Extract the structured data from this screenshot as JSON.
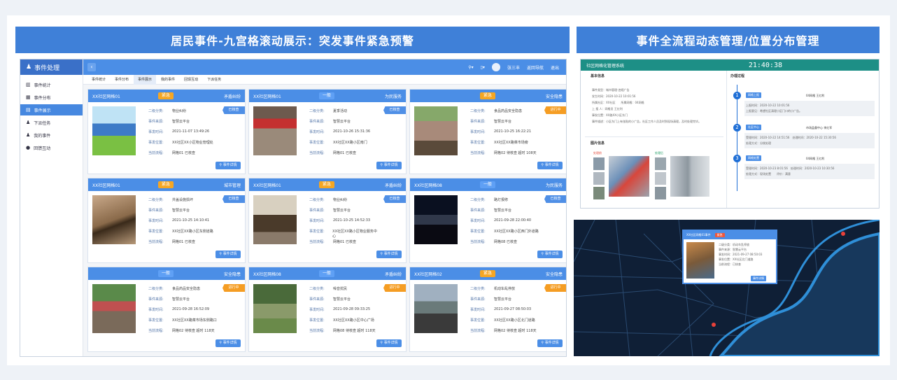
{
  "banners": {
    "left": "居民事件-九宫格滚动展示：突发事件紧急预警",
    "right": "事件全流程动态管理/位置分布管理"
  },
  "app": {
    "brand": "事件处理",
    "collapse": "‹",
    "menu": [
      {
        "icon": "bar-chart-icon",
        "glyph": "▥",
        "label": "事件统计"
      },
      {
        "icon": "map-icon",
        "glyph": "▦",
        "label": "事件分布"
      },
      {
        "icon": "list-icon",
        "glyph": "▤",
        "label": "事件展示"
      },
      {
        "icon": "user-icon",
        "glyph": "♟",
        "label": "下派任务"
      },
      {
        "icon": "user-icon",
        "glyph": "♟",
        "label": "我的事件"
      },
      {
        "icon": "chat-icon",
        "glyph": "●",
        "label": "回馈互动"
      }
    ],
    "top_user": "张三丰",
    "top_nav": "返回导航",
    "top_exit": "退出",
    "tabs": [
      "事件统计",
      "事件分布",
      "事件展示",
      "我的事件",
      "回馈互动",
      "下派任务"
    ],
    "field_labels": [
      "二级分类:",
      "事件来源:",
      "事发时间:",
      "事发位置:",
      "当前流程:"
    ],
    "detail_label": "事件详情",
    "cards": [
      {
        "grid": "XX社区网格01",
        "badge": "紧急",
        "badge_color": "#f5a623",
        "cat": "矛盾纠纷",
        "type": "物业纠纷",
        "source": "智慧云平台",
        "time": "2021-11-07 13:49:26",
        "place": "XX社区XX小区物业管理处",
        "flow": "网格01 已核查",
        "status": "已核查",
        "status_color": "#4f8fe6",
        "photo": "cartoon"
      },
      {
        "grid": "XX社区网格01",
        "badge": "一般",
        "badge_color": "#5fa0f5",
        "cat": "为民服务",
        "type": "夏季活动",
        "source": "智慧云平台",
        "time": "2021-10-26 15:31:36",
        "place": "XX社区XX路小区南门",
        "flow": "网格01 已核查",
        "status": "已核查",
        "status_color": "#4f8fe6",
        "photo": "shop"
      },
      {
        "grid": "",
        "badge": "紧急",
        "badge_color": "#f5a623",
        "cat": "安全隐患",
        "type": "食品药品安全隐患",
        "source": "智慧云平台",
        "time": "2021-10-25 16:22:21",
        "place": "XX社区XX路菜市场旁",
        "flow": "网格02 待核查 超时 108天",
        "status": "进行中",
        "status_color": "#f59d23",
        "photo": "street"
      },
      {
        "grid": "XX社区网格01",
        "badge": "紧急",
        "badge_color": "#f5a623",
        "cat": "城市管理",
        "type": "井盖设施损坏",
        "source": "智慧云平台",
        "time": "2021-10-25 14:10:41",
        "place": "XX社区XX路小区东侧道路",
        "flow": "网格01 已核查",
        "status": "已核查",
        "status_color": "#4f8fe6",
        "photo": "ground"
      },
      {
        "grid": "XX社区网格01",
        "badge": "紧急",
        "badge_color": "#f5a623",
        "cat": "矛盾纠纷",
        "type": "物业纠纷",
        "source": "智慧云平台",
        "time": "2021-10-25 14:52:33",
        "place": "XX社区XX路小区物业服务中心",
        "flow": "网格01 已核查",
        "status": "已核查",
        "status_color": "#4f8fe6",
        "photo": "meeting"
      },
      {
        "grid": "XX社区网格08",
        "badge": "一般",
        "badge_color": "#5fa0f5",
        "cat": "为民服务",
        "type": "路灯报修",
        "source": "智慧云平台",
        "time": "2021-09-28 22:00:40",
        "place": "XX社区XX路小区西门外道路",
        "flow": "网格08 已核查",
        "status": "已核查",
        "status_color": "#4f8fe6",
        "photo": "night"
      },
      {
        "grid": "",
        "badge": "一般",
        "badge_color": "#5fa0f5",
        "cat": "安全隐患",
        "type": "食品药品安全隐患",
        "source": "智慧云平台",
        "time": "2021-09-28 16:52:09",
        "place": "XX社区XX路菜市场东侧路口",
        "flow": "网格02 待核查 超时 118天",
        "status": "进行中",
        "status_color": "#f59d23",
        "photo": "market"
      },
      {
        "grid": "XX社区网格08",
        "badge": "一般",
        "badge_color": "#5fa0f5",
        "cat": "矛盾纠纷",
        "type": "噪音扰民",
        "source": "智慧云平台",
        "time": "2021-09-28 09:33:25",
        "place": "XX社区XX路小区中心广场",
        "flow": "网格08 待核查 超时 118天",
        "status": "进行中",
        "status_color": "#f59d23",
        "photo": "park"
      },
      {
        "grid": "XX社区网格02",
        "badge": "紧急",
        "badge_color": "#f5a623",
        "cat": "安全隐患",
        "type": "机动车乱停放",
        "source": "智慧云平台",
        "time": "2021-09-27 08:50:03",
        "place": "XX社区XX路小区北门道路",
        "flow": "网格02 待核查 超时 118天",
        "status": "进行中",
        "status_color": "#f59d23",
        "photo": "road"
      }
    ]
  },
  "system": {
    "name": "社区网格化管理系统",
    "clock": "21:40:38",
    "basic_info": "基本信息",
    "event_photos": "图片信息",
    "flow_title": "办理过程",
    "before": "处理前",
    "after": "处理后",
    "info_lines": [
      "事件类型：城市管理-违规广告",
      "发生时间：2020-10-22 10:01:56",
      "所属社区：XX社区　　所属网格：04网格",
      "上 报 人：网格员 王红利",
      "事发位置：XX路XX小区东门",
      "事件描述：小区东门上有张贴的小广告，社区工作人员及时到现场清理，及时处理完毕。"
    ],
    "steps": [
      {
        "tag": "网格上报",
        "person": "04网格 王红利",
        "lines": [
          "上报时间：2020-10-22 10:01:56",
          "上报意见：希望社区清理小区门口的小广告。"
        ]
      },
      {
        "tag": "社区中心",
        "person": "市场监督中心 李红军",
        "lines": [
          "受理时间：2020-10-22 14:51:56　处理时间：2020-10-22 15:30:56",
          "处理方式：分拨处理"
        ]
      },
      {
        "tag": "网格处置",
        "person": "04网格 王红利",
        "lines": [
          "受理时间：2020-10-23 8:01:56　处理时间：2020-10-23 10:30:56",
          "处理方式：现场处置　　评价：满意"
        ]
      }
    ]
  },
  "map": {
    "popup_title": "XX社区网格01事件",
    "popup_badge": "紧急",
    "popup_more": "事件详情",
    "popup_lines": [
      "二级分类：机动车乱停放",
      "事件来源：智慧云平台",
      "事发时间：2021-09-27 08:50:03",
      "事发位置：XX社区北门道路",
      "当前流程：已核查"
    ]
  }
}
